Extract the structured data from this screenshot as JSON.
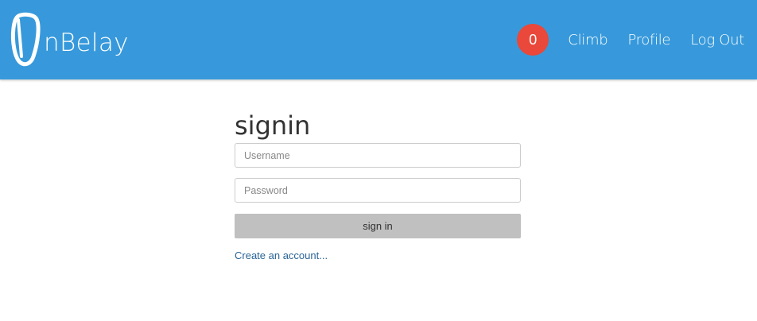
{
  "navbar": {
    "brand_text": "nBelay",
    "brand_icon": "carabiner-icon",
    "background_color": "#3799db",
    "notification_count": "0",
    "badge_color": "#e9483a",
    "links": [
      "Climb",
      "Profile",
      "Log Out"
    ]
  },
  "signin": {
    "title": "signin",
    "username_placeholder": "Username",
    "password_placeholder": "Password",
    "username_value": "",
    "password_value": "",
    "submit_label": "sign in",
    "submit_color": "#c0c0c0",
    "create_account_link": "Create an account...",
    "link_color": "#2a6496"
  }
}
